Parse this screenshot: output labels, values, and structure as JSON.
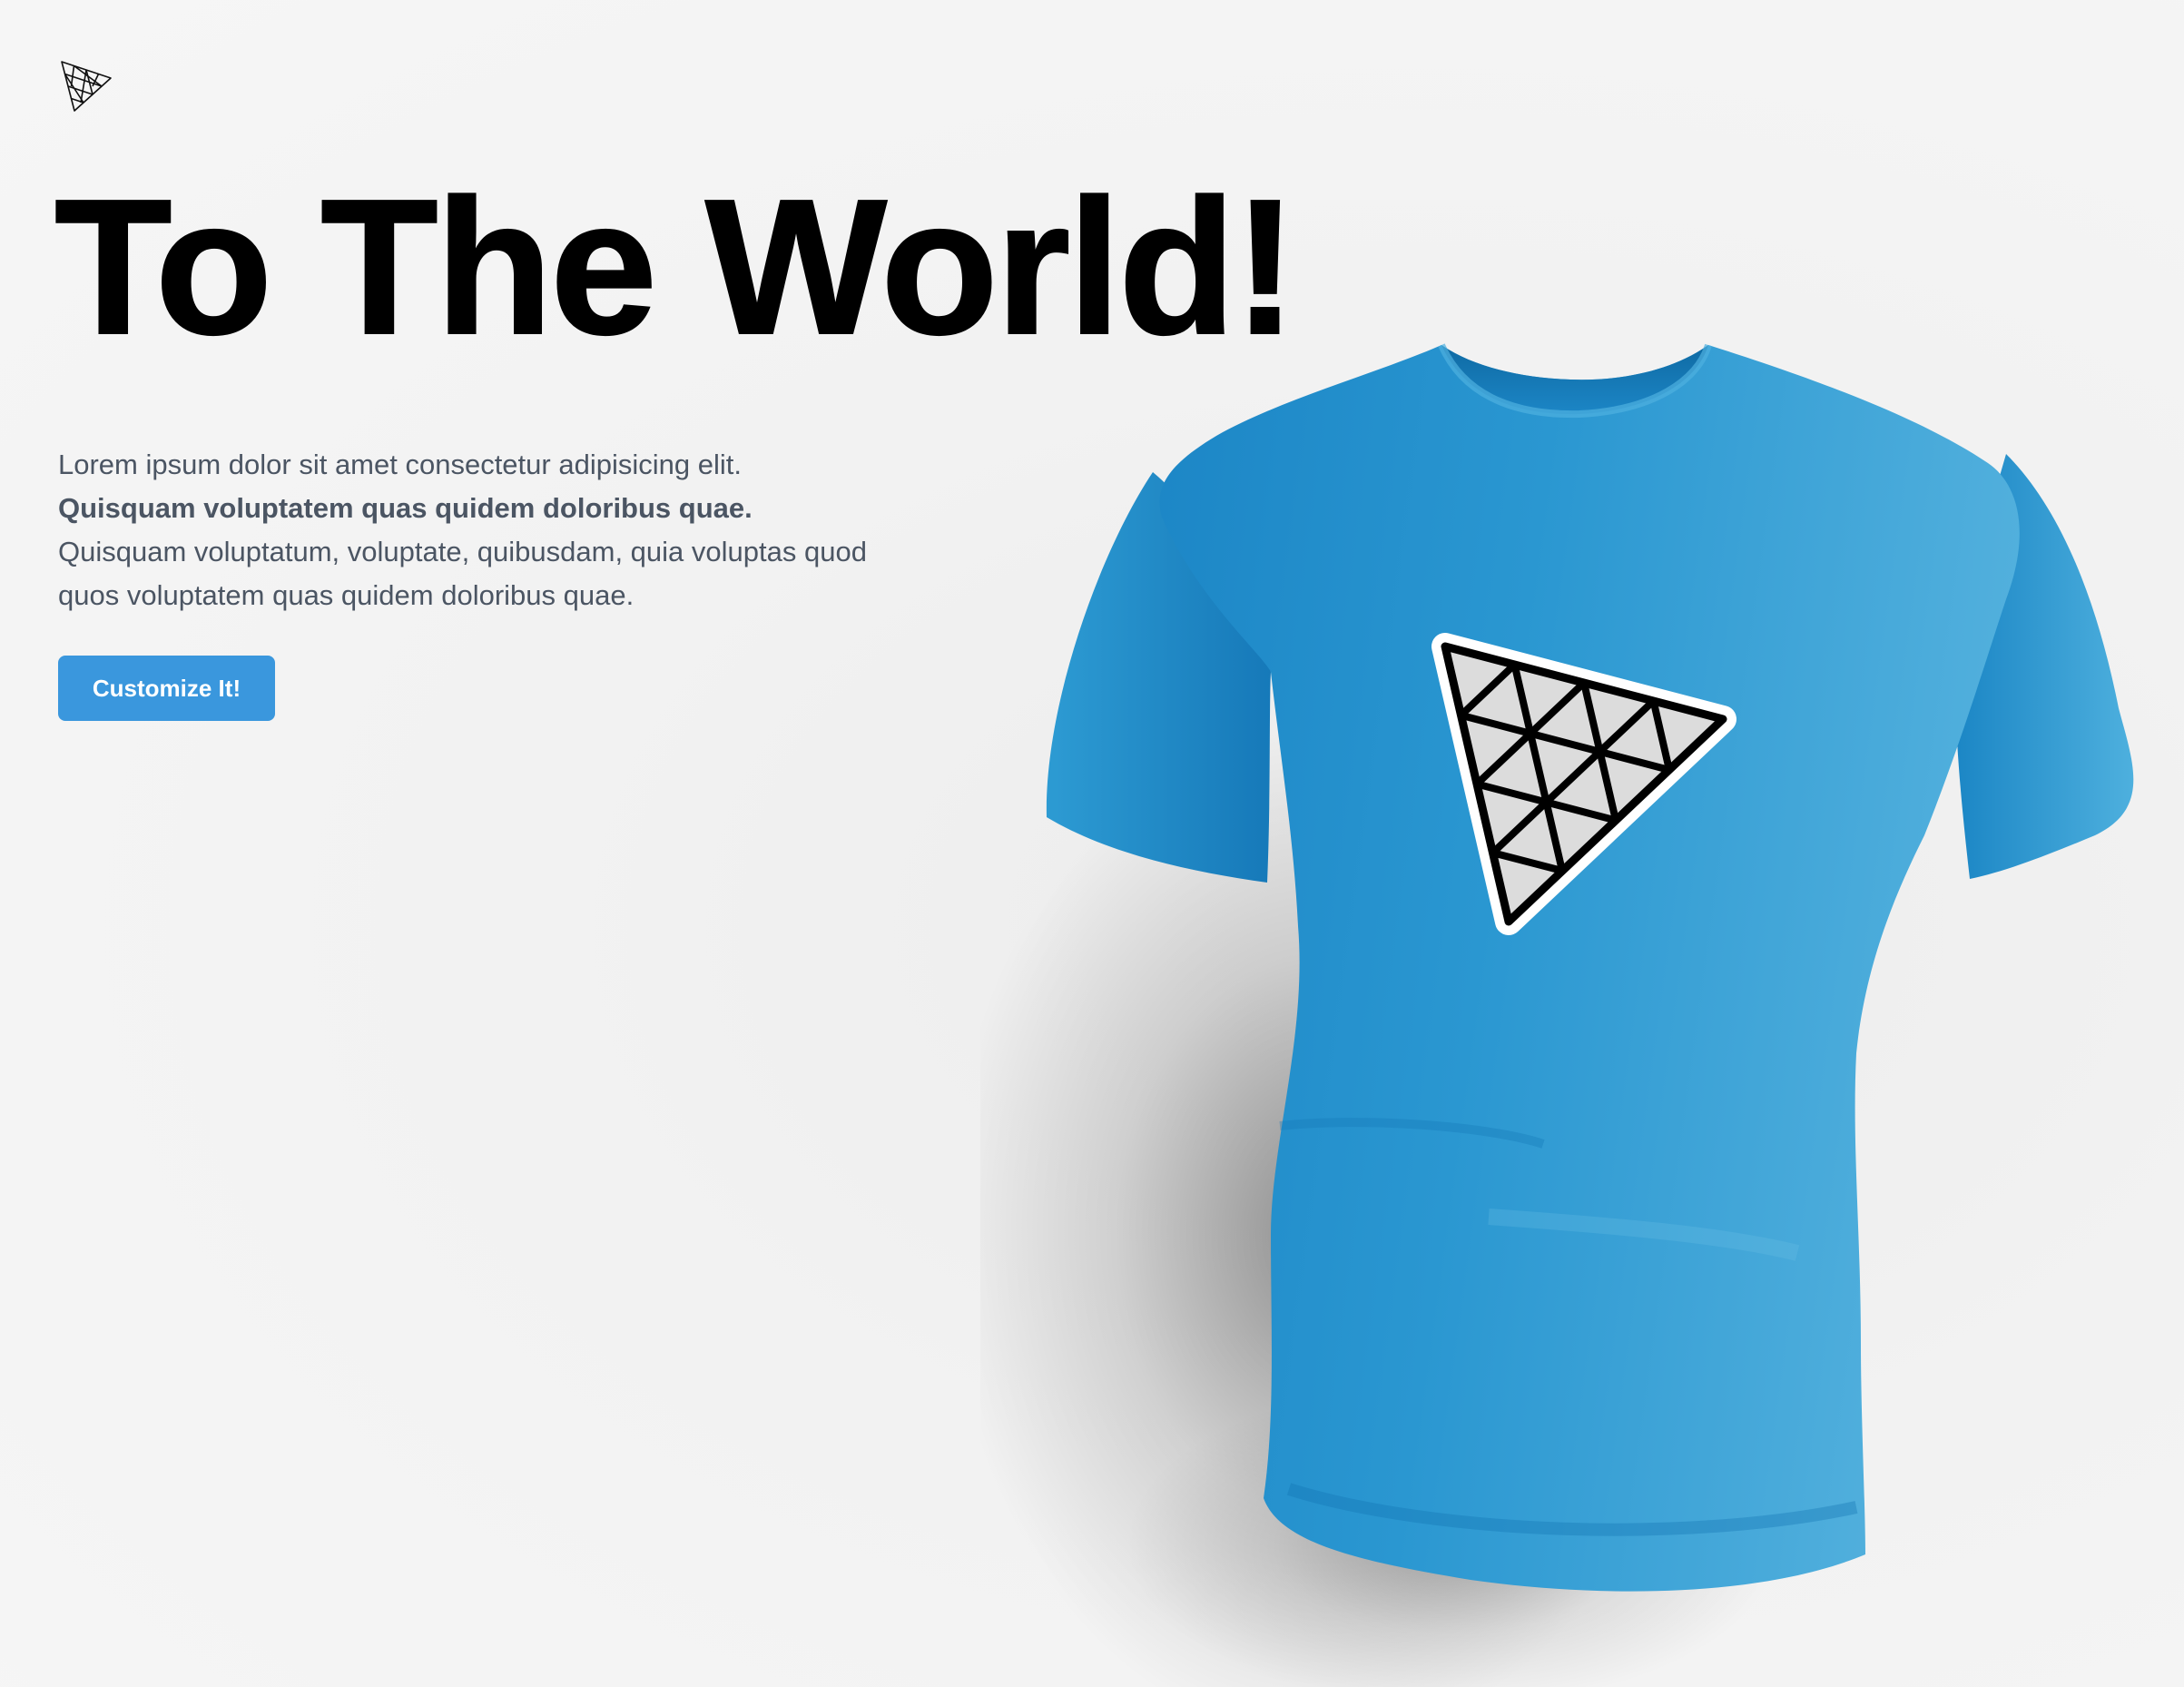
{
  "brand": {
    "logo_icon": "triangle-grid-logo-icon"
  },
  "hero": {
    "title": "To The World!",
    "intro_line1": "Lorem ipsum dolor sit amet consectetur adipisicing elit.",
    "intro_bold": "Quisquam voluptatem quas quidem doloribus quae.",
    "intro_rest": "Quisquam voluptatum, voluptate, quibusdam, quia voluptas quod quos voluptatem quas quidem doloribus quae.",
    "cta_label": "Customize It!"
  },
  "product": {
    "item": "t-shirt",
    "shirt_color": "#2a97d1",
    "decal_icon": "triangle-grid-decal-icon"
  },
  "colors": {
    "accent": "#3a97dd",
    "heading": "#000000",
    "body_text": "#4b5563",
    "background": "#f2f2f2"
  }
}
